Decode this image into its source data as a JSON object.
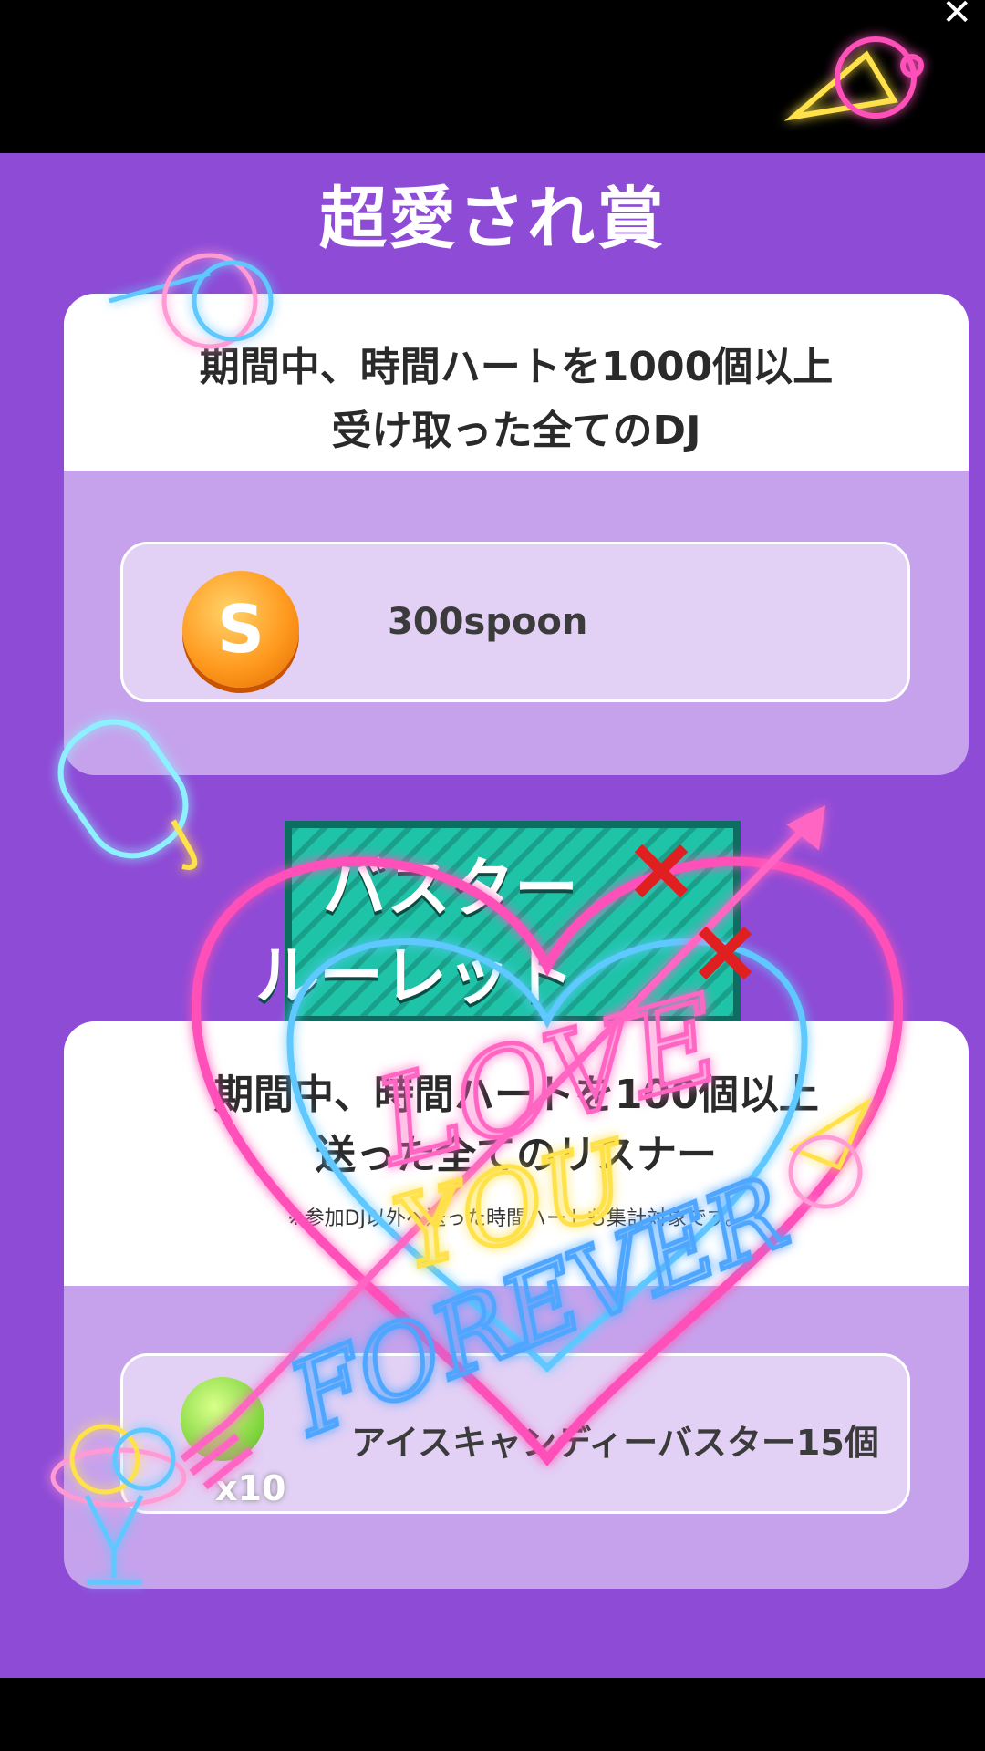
{
  "close_label": "✕",
  "section1": {
    "title": "超愛され賞",
    "condition_line1": "期間中、時間ハートを1000個以上",
    "condition_line2": "受け取った全てのDJ",
    "coin_letter": "S",
    "reward": "300spoon"
  },
  "badge": {
    "line1": "バスター",
    "line2": "ルーレット"
  },
  "section2": {
    "condition_line1": "期間中、時間ハートを100個以上",
    "condition_line2": "送った全てのリスナー",
    "note": "※参加DJ以外へ送った時間ハートも集計対象です。",
    "reward": "アイスキャンディーバスター15個",
    "candy_count": "x10"
  },
  "sticker": {
    "word1": "LOVE",
    "word2": "YOU",
    "word3": "FOREVER"
  },
  "colors": {
    "background": "#8e4bd6",
    "card": "#c6a2ec",
    "reward_box": "#e2d0f5",
    "badge": "#1fc3a8",
    "neon_pink": "#ff4fb8",
    "neon_blue": "#5fc8ff",
    "neon_yellow": "#ffe24a"
  }
}
